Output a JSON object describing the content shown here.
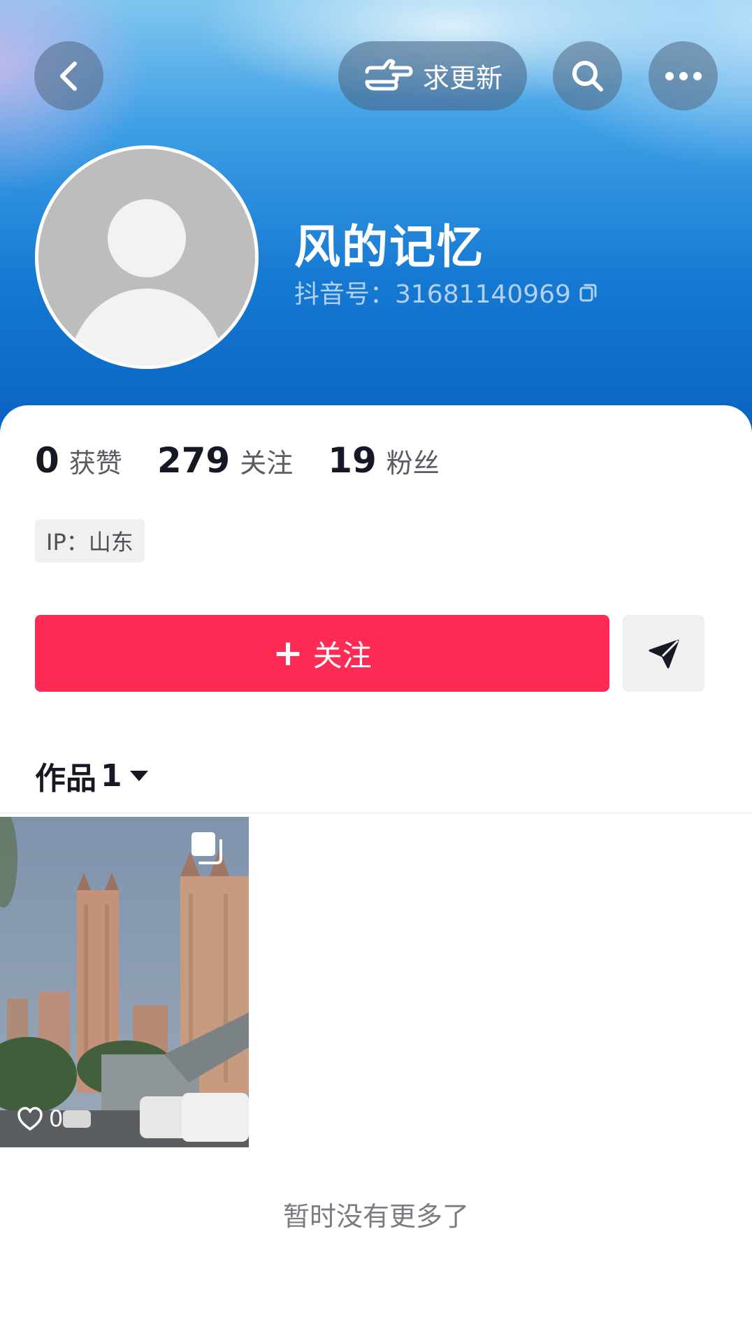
{
  "header": {
    "request_update_label": "求更新"
  },
  "profile": {
    "nickname": "风的记忆",
    "douyin_id": "抖音号：31681140969"
  },
  "stats": [
    {
      "value": "0",
      "label": "获赞"
    },
    {
      "value": "279",
      "label": "关注"
    },
    {
      "value": "19",
      "label": "粉丝"
    }
  ],
  "ip_tag": "IP：山东",
  "actions": {
    "follow_label": "关注",
    "follow_plus": "+"
  },
  "works_tab": {
    "label": "作品",
    "count": "1"
  },
  "videos": [
    {
      "likes": "0"
    }
  ],
  "footer": {
    "no_more_text": "暂时没有更多了"
  },
  "icons": [
    "back-icon",
    "hand-pointing-icon",
    "search-icon",
    "more-icon",
    "copy-icon",
    "send-icon",
    "caret-down-icon",
    "multi-image-icon",
    "heart-icon"
  ],
  "colors": {
    "accent": "#fe2c55",
    "text_primary": "#161823",
    "header_blue": "#1579d2"
  }
}
